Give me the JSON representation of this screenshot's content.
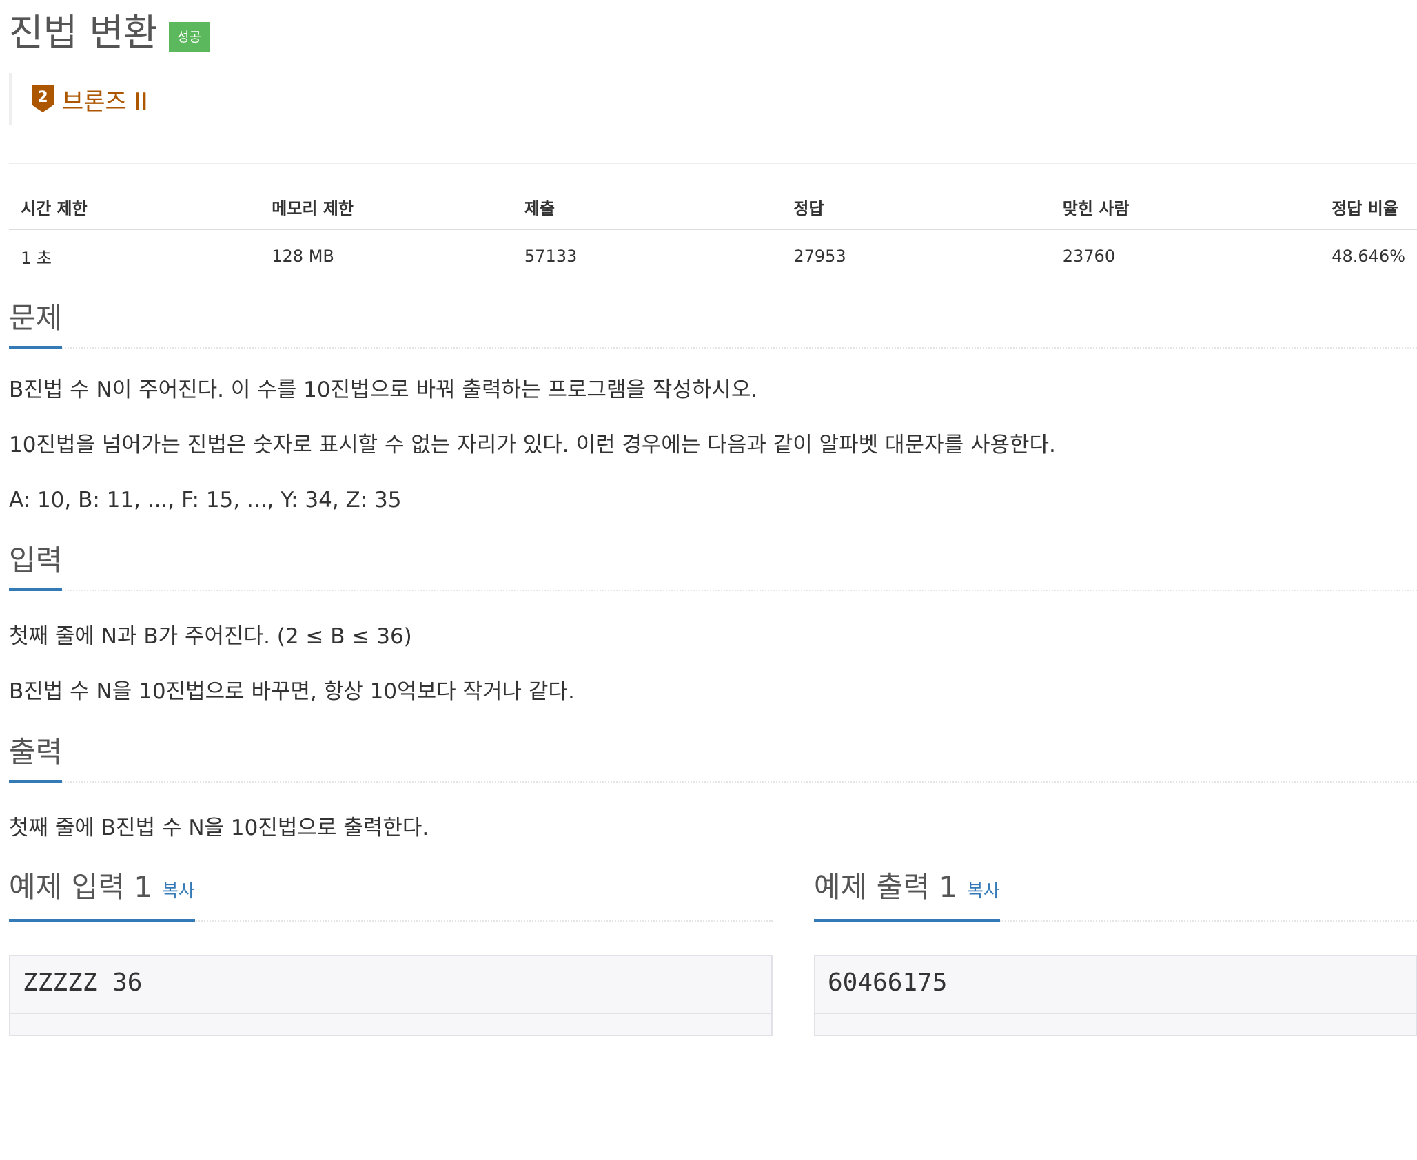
{
  "problem": {
    "title": "진법 변환",
    "status_badge": "성공",
    "tier": "브론즈 II",
    "tier_level": "2"
  },
  "info_table": {
    "headers": [
      "시간 제한",
      "메모리 제한",
      "제출",
      "정답",
      "맞힌 사람",
      "정답 비율"
    ],
    "values": [
      "1 초",
      "128 MB",
      "57133",
      "27953",
      "23760",
      "48.646%"
    ]
  },
  "sections": {
    "description": {
      "title": "문제",
      "paragraphs": [
        "B진법 수 N이 주어진다. 이 수를 10진법으로 바꿔 출력하는 프로그램을 작성하시오.",
        "10진법을 넘어가는 진법은 숫자로 표시할 수 없는 자리가 있다. 이런 경우에는 다음과 같이 알파벳 대문자를 사용한다.",
        "A: 10, B: 11, ..., F: 15, ..., Y: 34, Z: 35"
      ]
    },
    "input": {
      "title": "입력",
      "paragraphs": [
        "첫째 줄에 N과 B가 주어진다. (2 ≤ B ≤ 36)",
        "B진법 수 N을 10진법으로 바꾸면, 항상 10억보다 작거나 같다."
      ]
    },
    "output": {
      "title": "출력",
      "paragraphs": [
        "첫째 줄에 B진법 수 N을 10진법으로 출력한다."
      ]
    }
  },
  "samples": {
    "input": {
      "title": "예제 입력 1",
      "copy_label": "복사",
      "content": "ZZZZZ 36"
    },
    "output": {
      "title": "예제 출력 1",
      "copy_label": "복사",
      "content": "60466175"
    }
  },
  "colors": {
    "badge_success": "#5cb85c",
    "tier_bronze": "#ad5600",
    "accent": "#337ab7"
  }
}
